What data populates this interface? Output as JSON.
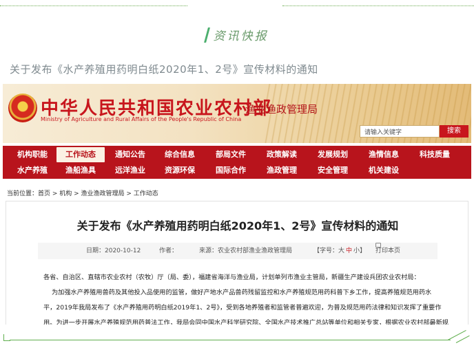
{
  "section": {
    "title": "资讯快报"
  },
  "article_link": "关于发布《水产养殖用药明白纸2020年1、2号》宣传材料的通知",
  "site": {
    "ministry_cn": "中华人民共和国农业农村部",
    "ministry_en": "Ministry of Agriculture and Rural Affairs of the People's Republic of China",
    "bureau": "渔业渔政管理局",
    "search_placeholder": "请输入关键字",
    "search_button": "搜索",
    "brand_red": "#c8161d"
  },
  "nav": {
    "row1": [
      "机构职能",
      "工作动态",
      "通知公告",
      "综合信息",
      "部局文件",
      "政策解读",
      "发展规划",
      "渔情信息",
      "科技质量"
    ],
    "row2": [
      "水产养殖",
      "渔船渔具",
      "远洋渔业",
      "资源环保",
      "国际合作",
      "渔政管理",
      "安全管理",
      "机关建设"
    ],
    "active": "工作动态"
  },
  "breadcrumb": "当前位置：首页 > 机构 > 渔业渔政管理局 > 工作动态",
  "doc": {
    "title": "关于发布《水产养殖用药明白纸2020年1、2号》宣传材料的通知",
    "date": "日期：2020-10-12",
    "author": "作者：",
    "source": "来源：农业农村部渔业渔政管理局",
    "font_prefix": "【字号：",
    "font_large": "大",
    "font_medium": "中",
    "font_small": "小",
    "font_suffix": "】",
    "print": "打印本页",
    "lines": [
      "各省、自治区、直辖市农业农村（农牧）厅（局、委），福建省海洋与渔业局，计划单列市渔业主管局，新疆生产建设兵团农业农村局：",
      "为加强水产养殖用兽药及其他投入品使用的监管，做好产地水产品兽药残留监控和水产养殖规范用药科普下乡工作，提高养殖规范用药水",
      "平，2019年我局发布了《水产养殖用药明白纸2019年1、2号》，受到各地养殖者和监管者普遍欢迎，为普及规范用药法律和知识发挥了重要作",
      "用。为进一步开展水产养殖规范用药普法工作，我局会同中国水产科学研究院、全国水产技术推广总站等单位和相关专家，根据农业农村部最新规"
    ]
  }
}
